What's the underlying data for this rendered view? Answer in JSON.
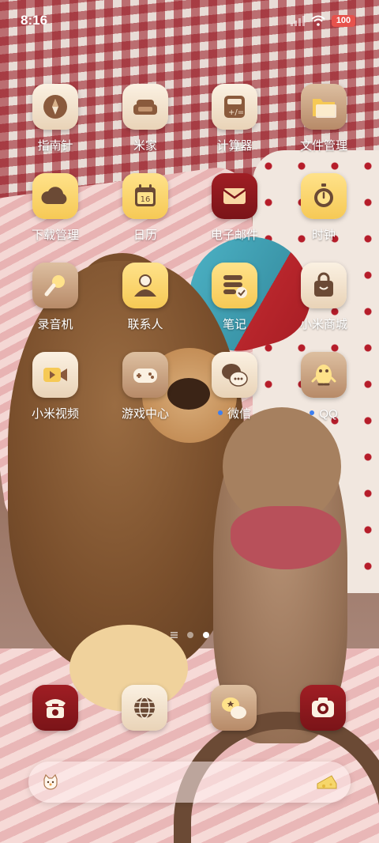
{
  "status_bar": {
    "time": "8:16",
    "battery": "100",
    "signal_icon": "cellular-signal-icon",
    "wifi_icon": "wifi-icon",
    "battery_color": "#e7524c"
  },
  "home": {
    "rows": [
      [
        {
          "label": "指南针",
          "icon": "compass-icon",
          "dot": false
        },
        {
          "label": "米家",
          "icon": "sofa-icon",
          "dot": false
        },
        {
          "label": "计算器",
          "icon": "calculator-icon",
          "dot": false
        },
        {
          "label": "文件管理",
          "icon": "folder-icon",
          "dot": false
        }
      ],
      [
        {
          "label": "下载管理",
          "icon": "cloud-icon",
          "dot": false
        },
        {
          "label": "日历",
          "icon": "calendar-icon",
          "calendar_day": "16",
          "dot": false
        },
        {
          "label": "电子邮件",
          "icon": "envelope-icon",
          "dot": false
        },
        {
          "label": "时钟",
          "icon": "stopwatch-icon",
          "dot": false
        }
      ],
      [
        {
          "label": "录音机",
          "icon": "microphone-icon",
          "dot": false
        },
        {
          "label": "联系人",
          "icon": "contact-person-icon",
          "dot": false
        },
        {
          "label": "笔记",
          "icon": "notes-check-icon",
          "dot": false
        },
        {
          "label": "小米商城",
          "icon": "shopping-bag-icon",
          "dot": false
        }
      ],
      [
        {
          "label": "小米视频",
          "icon": "video-camera-icon",
          "dot": false
        },
        {
          "label": "游戏中心",
          "icon": "gamepad-icon",
          "dot": false
        },
        {
          "label": "微信",
          "icon": "wechat-icon",
          "dot": true
        },
        {
          "label": "QQ",
          "icon": "qq-penguin-icon",
          "dot": true
        }
      ]
    ],
    "new_badge_color": "#3d7ff0"
  },
  "page_indicator": {
    "pages": 2,
    "active_page": 2
  },
  "dock": [
    {
      "icon": "telephone-icon"
    },
    {
      "icon": "browser-globe-icon"
    },
    {
      "icon": "messages-icon"
    },
    {
      "icon": "camera-icon"
    }
  ],
  "search_bar": {
    "left_icon": "cat-face-icon",
    "right_icon": "cheese-icon"
  }
}
